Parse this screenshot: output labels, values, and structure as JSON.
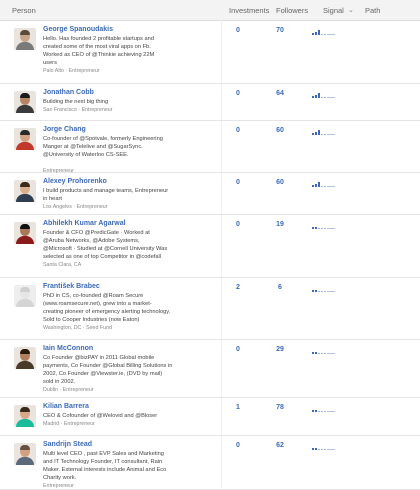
{
  "header": {
    "person": "Person",
    "investments": "Investments",
    "followers": "Followers",
    "signal": "Signal",
    "sort_arrow": "⌄",
    "path": "Path"
  },
  "people": [
    {
      "name": "George Spanoudakis",
      "bio": [
        "Hello. Has founded 2 profitable startups and",
        "created some of the most viral apps on Fb.",
        "Worked as CEO of @Thinkie achieving 22M",
        "users"
      ],
      "meta": "Palo Alto · Entrepreneur",
      "investments": "0",
      "followers": "70",
      "signal_level": 0.55,
      "avatar": {
        "skin": "#c9a58a",
        "shirt": "#7a7a7a",
        "hair": "#5a4a3a"
      }
    },
    {
      "name": "Jonathan Cobb",
      "bio": [
        "Building the next big thing"
      ],
      "meta": "San Francisco · Entrepreneur",
      "investments": "0",
      "followers": "64",
      "signal_level": 0.55,
      "avatar": {
        "skin": "#b88466",
        "shirt": "#3a3a3a",
        "hair": "#1a1a1a"
      }
    },
    {
      "name": "Jorge Chang",
      "bio": [
        "Co-founder of @Spotvale, formerly Engineering",
        "Manger at @Telelive and @SugarSync.",
        "@University of Waterloo CS-SEE.",
        ""
      ],
      "meta": "Entrepreneur",
      "investments": "0",
      "followers": "60",
      "signal_level": 0.55,
      "avatar": {
        "skin": "#d4a284",
        "shirt": "#c0392b",
        "hair": "#2a2a2a"
      }
    },
    {
      "name": "Alexey Prohorenko",
      "bio": [
        "I build products and manage teams, Entrepreneur",
        "in heart"
      ],
      "meta": "Los Angeles · Entrepreneur",
      "investments": "0",
      "followers": "60",
      "signal_level": 0.55,
      "avatar": {
        "skin": "#d8b090",
        "shirt": "#2c3e50",
        "hair": "#3a2a1a"
      }
    },
    {
      "name": "Abhilekh Kumar Agarwal",
      "bio": [
        "Founder & CFO @PredicGate · Worked at",
        "@Aruba Networks, @Adobe Systems,",
        "@Microsoft · Studied at @Cornell University Was",
        "selected as one of top Competitor in @codefall"
      ],
      "meta": "Santa Clara, CA",
      "investments": "0",
      "followers": "19",
      "signal_level": 0.3,
      "avatar": {
        "skin": "#a8785a",
        "shirt": "#8b1a1a",
        "hair": "#111111"
      }
    },
    {
      "name": "František Brabec",
      "bio": [
        "PhD in CS, co-founded @Roam Secure",
        "(www.roamsecure.net), grew into a market-",
        "creating pioneer of emergency alerting technology.",
        "Sold to Cooper Industries (now Eaton)"
      ],
      "meta": "Washington, DC · Seed Fund",
      "investments": "2",
      "followers": "6",
      "signal_level": 0.2,
      "avatar": {
        "skin": "#e6e6e6",
        "shirt": "#d5d5d5",
        "hair": "#cfcfcf"
      }
    },
    {
      "name": "Iain McConnon",
      "bio": [
        "Co Founder @bizPAY in 2011 Global mobile",
        "payments, Co Founder @Global Billing Solutions in",
        "2002, Co Founder @Viewster.ie, (DVD by mail)",
        "sold in 2002."
      ],
      "meta": "Dublin · Entrepreneur",
      "investments": "0",
      "followers": "29",
      "signal_level": 0.2,
      "avatar": {
        "skin": "#b08060",
        "shirt": "#4a3a2a",
        "hair": "#2a1a0a"
      }
    },
    {
      "name": "Kilian Barrera",
      "bio": [
        "CEO & Cofounder of @Welovid and @Bloser"
      ],
      "meta": "Madrid · Entrepreneur",
      "investments": "1",
      "followers": "78",
      "signal_level": 0.2,
      "avatar": {
        "skin": "#d8a888",
        "shirt": "#1abc9c",
        "hair": "#3a2a1a"
      }
    },
    {
      "name": "Sandrijn Stead",
      "bio": [
        "Multi level CEO , past EVP Sales and Marketing",
        "and IT Technology Founder, IT consultant, Rain",
        "Maker. External interests include Animal and Eco",
        "Charity work."
      ],
      "meta": "Entrepreneur",
      "investments": "0",
      "followers": "62",
      "signal_level": 0.2,
      "avatar": {
        "skin": "#d0a080",
        "shirt": "#5a6a7a",
        "hair": "#6a5040"
      }
    }
  ]
}
